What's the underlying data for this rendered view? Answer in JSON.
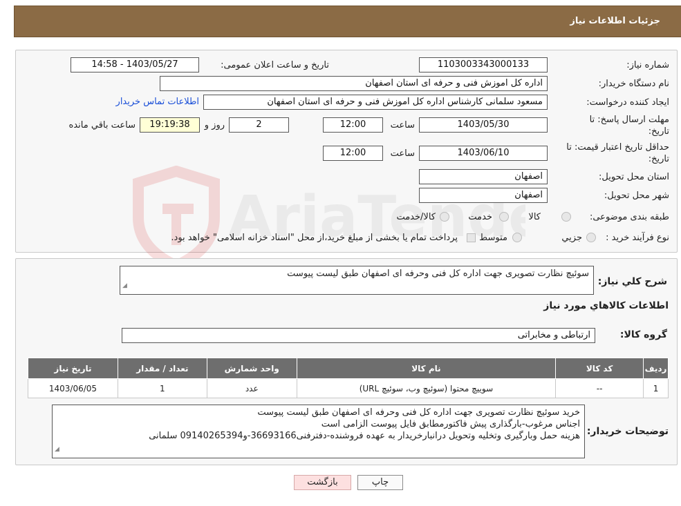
{
  "header": {
    "title": "جزئیات اطلاعات نیاز"
  },
  "fields": {
    "need_number_label": "شماره نیاز:",
    "need_number": "1103003343000133",
    "announce_label": "تاریخ و ساعت اعلان عمومی:",
    "announce_value": "1403/05/27 - 14:58",
    "buyer_label": "نام دستگاه خریدار:",
    "buyer_value": "اداره کل اموزش فنی و حرفه ای استان اصفهان",
    "creator_label": "ایجاد کننده درخواست:",
    "creator_value": "مسعود سلمانی کارشناس اداره کل اموزش فنی و حرفه ای استان اصفهان",
    "contact_link": "اطلاعات تماس خریدار",
    "deadline_label_1": "مهلت ارسال پاسخ: تا",
    "deadline_label_2": "تاریخ:",
    "deadline_date": "1403/05/30",
    "time_label": "ساعت",
    "deadline_time": "12:00",
    "days_value": "2",
    "days_label": "روز و",
    "remaining_time": "19:19:38",
    "remaining_label": "ساعت باقي مانده",
    "validity_label_1": "حداقل تاریخ اعتبار قیمت: تا",
    "validity_label_2": "تاریخ:",
    "validity_date": "1403/06/10",
    "validity_time": "12:00",
    "province_label": "استان محل تحویل:",
    "province_value": "اصفهان",
    "city_label": "شهر محل تحویل:",
    "city_value": "اصفهان",
    "category_label": "طبقه بندی موضوعی:",
    "category_options": [
      "کالا",
      "خدمت",
      "کالا/خدمت"
    ],
    "process_label": "نوع فرآیند خرید :",
    "process_options": [
      "جزيي",
      "متوسط"
    ],
    "payment_note": "پرداخت تمام یا بخشی از مبلغ خرید،از محل \"اسناد خزانه اسلامی\" خواهد بود."
  },
  "description": {
    "label": "شرح کلي نياز:",
    "value": "سوئیچ نظارت تصویری جهت اداره کل  فنی وحرفه ای اصفهان طبق لیست پیوست"
  },
  "goods": {
    "section_title": "اطلاعات کالاهاي مورد نياز",
    "group_label": "گروه کالا:",
    "group_value": "ارتباطی و مخابراتی",
    "table": {
      "headers": [
        "رديف",
        "کد کالا",
        "نام کالا",
        "واحد شمارش",
        "تعداد / مقدار",
        "تاریخ نیاز"
      ],
      "rows": [
        [
          "1",
          "--",
          "سوییچ محتوا (سوئیچ وب، سوئیچ URL)",
          "عدد",
          "1",
          "1403/06/05"
        ]
      ]
    }
  },
  "buyer_notes": {
    "label": "توضیحات خریدار:",
    "lines": [
      "خرید سوئیچ نظارت تصویری جهت اداره کل  فنی وحرفه ای اصفهان طبق لیست پیوست",
      "اجناس مرغوب-بارگذاری پیش فاکتورمطابق فایل پیوست الزامی است",
      "هزینه حمل وبارگیری وتخلیه وتحویل درانبارخریدار به عهده فروشنده-دفترفنی36693166-و09140265394 سلمانی"
    ]
  },
  "buttons": {
    "print": "چاپ",
    "back": "بازگشت"
  },
  "watermark": {
    "text": "AriaTender.neT"
  }
}
